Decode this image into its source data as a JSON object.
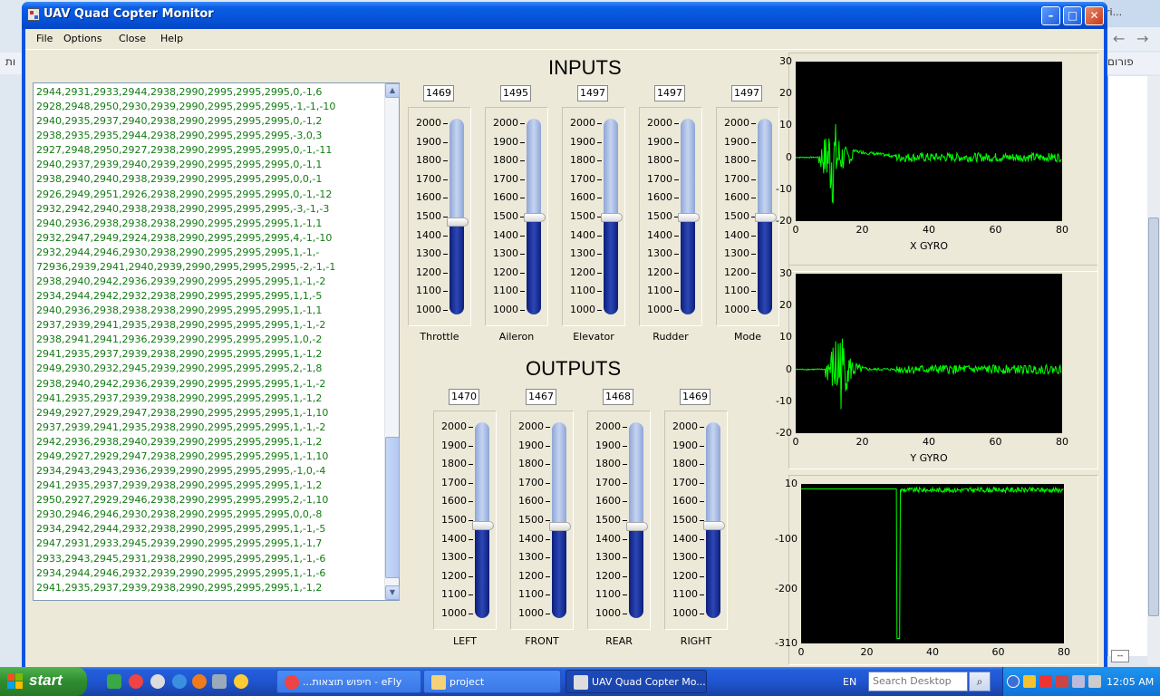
{
  "window": {
    "title": "UAV Quad Copter Monitor"
  },
  "menu": [
    "File",
    "Options",
    "Close",
    "Help"
  ],
  "log_lines": [
    "2944,2931,2933,2944,2938,2990,2995,2995,2995,0,-1,6",
    "2928,2948,2950,2930,2939,2990,2995,2995,2995,-1,-1,-10",
    "2940,2935,2937,2940,2938,2990,2995,2995,2995,0,-1,2",
    "2938,2935,2935,2944,2938,2990,2995,2995,2995,-3,0,3",
    "2927,2948,2950,2927,2938,2990,2995,2995,2995,0,-1,-11",
    "2940,2937,2939,2940,2939,2990,2995,2995,2995,0,-1,1",
    "2938,2940,2940,2938,2939,2990,2995,2995,2995,0,0,-1",
    "2926,2949,2951,2926,2938,2990,2995,2995,2995,0,-1,-12",
    "2932,2942,2940,2938,2938,2990,2995,2995,2995,-3,-1,-3",
    "2940,2936,2938,2938,2938,2990,2995,2995,2995,1,-1,1",
    "2932,2947,2949,2924,2938,2990,2995,2995,2995,4,-1,-10",
    "2932,2944,2946,2930,2938,2990,2995,2995,2995,1,-1,-",
    "72936,2939,2941,2940,2939,2990,2995,2995,2995,-2,-1,-1",
    "2938,2940,2942,2936,2939,2990,2995,2995,2995,1,-1,-2",
    "2934,2944,2942,2932,2938,2990,2995,2995,2995,1,1,-5",
    "2940,2936,2938,2938,2938,2990,2995,2995,2995,1,-1,1",
    "2937,2939,2941,2935,2938,2990,2995,2995,2995,1,-1,-2",
    "2938,2941,2941,2936,2939,2990,2995,2995,2995,1,0,-2",
    "2941,2935,2937,2939,2938,2990,2995,2995,2995,1,-1,2",
    "2949,2930,2932,2945,2939,2990,2995,2995,2995,2,-1,8",
    "2938,2940,2942,2936,2939,2990,2995,2995,2995,1,-1,-2",
    "2941,2935,2937,2939,2938,2990,2995,2995,2995,1,-1,2",
    "2949,2927,2929,2947,2938,2990,2995,2995,2995,1,-1,10",
    "2937,2939,2941,2935,2938,2990,2995,2995,2995,1,-1,-2",
    "2942,2936,2938,2940,2939,2990,2995,2995,2995,1,-1,2",
    "2949,2927,2929,2947,2938,2990,2995,2995,2995,1,-1,10",
    "2934,2943,2943,2936,2939,2990,2995,2995,2995,-1,0,-4",
    "2941,2935,2937,2939,2938,2990,2995,2995,2995,1,-1,2",
    "2950,2927,2929,2946,2938,2990,2995,2995,2995,2,-1,10",
    "2930,2946,2946,2930,2938,2990,2995,2995,2995,0,0,-8",
    "2934,2942,2944,2932,2938,2990,2995,2995,2995,1,-1,-5",
    "2947,2931,2933,2945,2939,2990,2995,2995,2995,1,-1,7",
    "2933,2943,2945,2931,2938,2990,2995,2995,2995,1,-1,-6",
    "2934,2944,2946,2932,2939,2990,2995,2995,2995,1,-1,-6",
    "2941,2935,2937,2939,2938,2990,2995,2995,2995,1,-1,2"
  ],
  "inputs": {
    "title": "INPUTS",
    "sliders": [
      {
        "label": "Throttle",
        "value": 1469
      },
      {
        "label": "Aileron",
        "value": 1495
      },
      {
        "label": "Elevator",
        "value": 1497
      },
      {
        "label": "Rudder",
        "value": 1497
      },
      {
        "label": "Mode",
        "value": 1497
      }
    ]
  },
  "outputs": {
    "title": "OUTPUTS",
    "sliders": [
      {
        "label": "LEFT",
        "value": 1470
      },
      {
        "label": "FRONT",
        "value": 1467
      },
      {
        "label": "REAR",
        "value": 1468
      },
      {
        "label": "RIGHT",
        "value": 1469
      }
    ]
  },
  "slider_scale": {
    "min": 1000,
    "max": 2000,
    "ticks": [
      "2000",
      "1900",
      "1800",
      "1700",
      "1600",
      "1500",
      "1400",
      "1300",
      "1200",
      "1100",
      "1000"
    ]
  },
  "graphs": [
    {
      "title": "X GYRO",
      "yticks": [
        "30",
        "20",
        "10",
        "0",
        "-10",
        "-20"
      ],
      "xticks": [
        "0",
        "20",
        "40",
        "60",
        "80"
      ],
      "ylim": [
        -20,
        30
      ],
      "xlim": [
        0,
        80
      ]
    },
    {
      "title": "Y GYRO",
      "yticks": [
        "30",
        "20",
        "10",
        "0",
        "-10",
        "-20"
      ],
      "xticks": [
        "0",
        "20",
        "40",
        "60",
        "80"
      ],
      "ylim": [
        -20,
        30
      ],
      "xlim": [
        0,
        80
      ]
    },
    {
      "title": "",
      "yticks": [
        "10",
        "-100",
        "-200",
        "-310"
      ],
      "xticks": [
        "0",
        "20",
        "40",
        "60",
        "80"
      ],
      "ylim": [
        -310,
        10
      ],
      "xlim": [
        0,
        80
      ]
    }
  ],
  "colors": {
    "trace": "#00ff00",
    "log_text": "#127b12",
    "plot_bg": "#000000"
  },
  "taskbar": {
    "start": "start",
    "tasks": [
      "...חיפוש תוצאות - eFly",
      "project",
      "UAV Quad Copter Mo..."
    ],
    "lang": "EN",
    "search_placeholder": "Search Desktop",
    "clock": "12:05 AM"
  },
  "background": {
    "tab_text": "ri...",
    "bookmark_left": "ות",
    "bookmark_right": "פורום",
    "bottom_box": "--"
  }
}
